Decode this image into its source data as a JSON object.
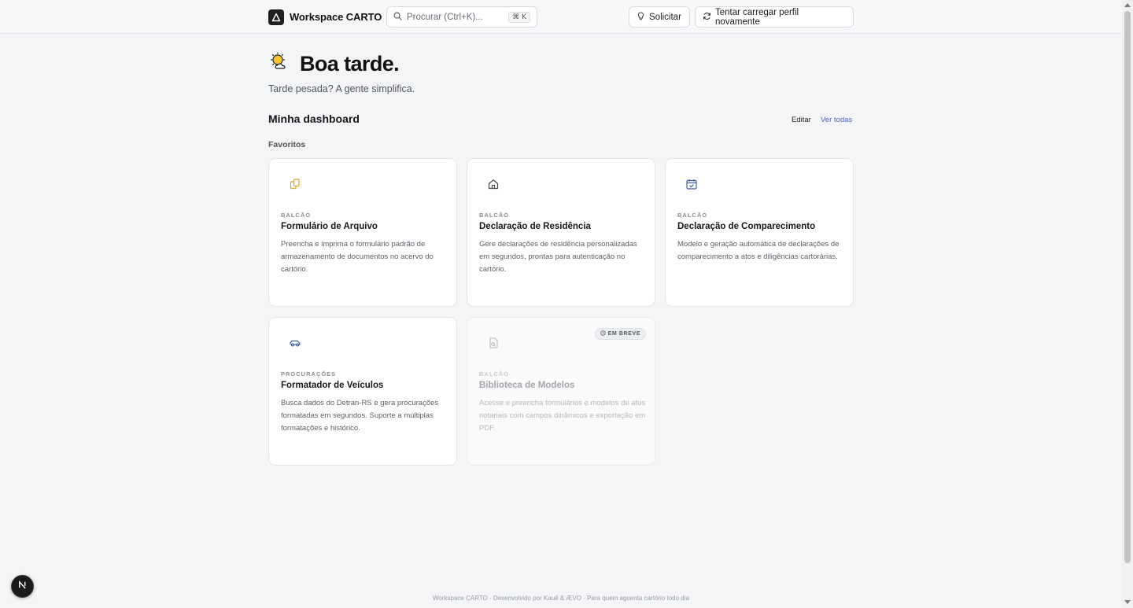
{
  "header": {
    "brand": "Workspace CARTO",
    "search_placeholder": "Procurar (Ctrl+K)...",
    "search_shortcut": "⌘ K",
    "request_label": "Solicitar",
    "reload_label": "Tentar carregar perfil novamente"
  },
  "greeting": {
    "title": "Boa tarde.",
    "subtitle": "Tarde pesada? A gente simplifica."
  },
  "dashboard": {
    "title": "Minha dashboard",
    "edit_label": "Editar",
    "see_all_label": "Ver todas",
    "favorites_label": "Favoritos"
  },
  "cards": [
    {
      "icon": "files-icon",
      "category": "BALCÃO",
      "title": "Formulário de Arquivo",
      "description": "Preencha e imprima o formulário padrão de armazenamento de documentos no acervo do cartório."
    },
    {
      "icon": "home-icon",
      "category": "BALCÃO",
      "title": "Declaração de Residência",
      "description": "Gere declarações de residência personalizadas em segundos, prontas para autenticação no cartório."
    },
    {
      "icon": "calendar-check-icon",
      "category": "BALCÃO",
      "title": "Declaração de Comparecimento",
      "description": "Modelo e geração automática de declarações de comparecimento a atos e diligências cartorárias."
    },
    {
      "icon": "car-icon",
      "category": "PROCURAÇÕES",
      "title": "Formatador de Veículos",
      "description": "Busca dados do Detran-RS e gera procurações formatadas em segundos. Suporte a múltiplas formatações e histórico."
    },
    {
      "icon": "file-search-icon",
      "category": "BALCÃO",
      "title": "Biblioteca de Modelos",
      "description": "Acesse e preencha formulários e modelos de atos notariais com campos dinâmicos e exportação em PDF.",
      "badge": "EM BREVE"
    }
  ],
  "footer": {
    "text": "Workspace CARTO · Desenvolvido por Kauê & ÆVO · Para quem aguenta cartório todo dia"
  },
  "colors": {
    "accent_link": "#4a62c9",
    "icon_yellow": "#e0a81e",
    "icon_blue": "#3d5aa8"
  }
}
